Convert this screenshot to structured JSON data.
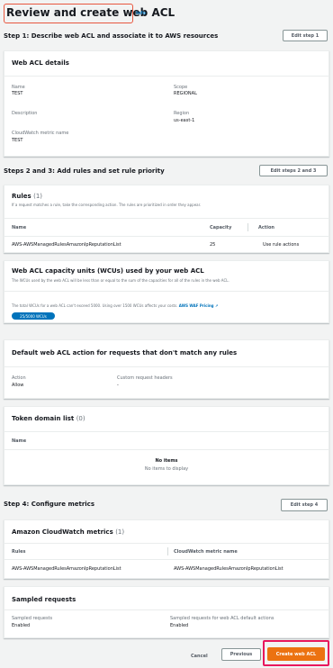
{
  "page": {
    "title": "Review and create web ACL",
    "info": "Info"
  },
  "step1": {
    "heading": "Step 1: Describe web ACL and associate it to AWS resources",
    "edit": "Edit step 1",
    "card_title": "Web ACL details",
    "name_label": "Name",
    "name_value": "TEST",
    "description_label": "Description",
    "metric_label": "CloudWatch metric name",
    "metric_value": "TEST",
    "scope_label": "Scope",
    "scope_value": "REGIONAL",
    "region_label": "Region",
    "region_value": "us-east-1"
  },
  "step2": {
    "heading": "Steps 2 and 3: Add rules and set rule priority",
    "edit": "Edit steps 2 and 3",
    "rules_title": "Rules",
    "rules_count": "(1)",
    "rules_desc": "If a request matches a rule, take the corresponding action. The rules are prioritized in order they appear.",
    "col_name": "Name",
    "col_capacity": "Capacity",
    "col_action": "Action",
    "row_name": "AWS-AWSManagedRulesAmazonIpReputationList",
    "row_capacity": "25",
    "row_action": "Use rule actions",
    "wcu_title": "Web ACL capacity units (WCUs) used by your web ACL",
    "wcu_desc": "The WCUs used by the web ACL will be less than or equal to the sum of the capacities for all of the rules in the web ACL.",
    "wcu_note": "The total WCUs for a web ACL can't exceed 5000. Using over 1500 WCUs affects your costs.",
    "wcu_link": "AWS WAF Pricing",
    "wcu_badge": "25/5000 WCUs",
    "default_title": "Default web ACL action for requests that don't match any rules",
    "action_label": "Action",
    "action_value": "Allow",
    "headers_label": "Custom request headers",
    "headers_value": "-",
    "token_title": "Token domain list",
    "token_count": "(0)",
    "token_col": "Name",
    "no_items": "No items",
    "no_items_sub": "No items to display"
  },
  "step4": {
    "heading": "Step 4: Configure metrics",
    "edit": "Edit step 4",
    "cw_title": "Amazon CloudWatch metrics",
    "cw_count": "(1)",
    "col_rules": "Rules",
    "col_metric": "CloudWatch metric name",
    "row_rule": "AWS-AWSManagedRulesAmazonIpReputationList",
    "row_metric": "AWS-AWSManagedRulesAmazonIpReputationList",
    "sampled_title": "Sampled requests",
    "sampled_label": "Sampled requests",
    "sampled_value": "Enabled",
    "sampled_default_label": "Sampled requests for web ACL default actions",
    "sampled_default_value": "Enabled"
  },
  "footer": {
    "cancel": "Cancel",
    "previous": "Previous",
    "create": "Create web ACL"
  }
}
